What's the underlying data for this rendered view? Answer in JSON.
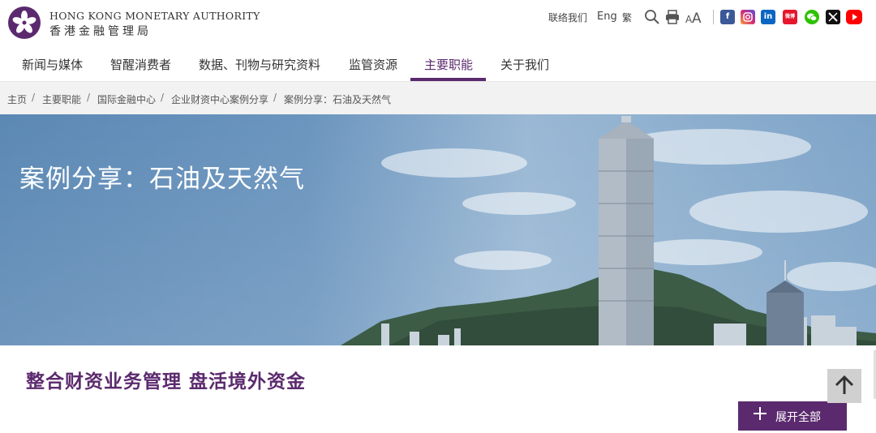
{
  "header": {
    "logo_en": "HONG KONG MONETARY AUTHORITY",
    "logo_zh": "香港金融管理局",
    "utility": {
      "contact": "联络我们",
      "eng": "Eng",
      "trad": "繁"
    },
    "icons": [
      "search-icon",
      "print-icon",
      "font-size-icon"
    ],
    "social": [
      "facebook-icon",
      "instagram-icon",
      "linkedin-icon",
      "weibo-icon",
      "wechat-icon",
      "x-icon",
      "youtube-icon"
    ]
  },
  "nav": {
    "items": [
      "新闻与媒体",
      "智醒消费者",
      "数据、刊物与研究资料",
      "监管资源",
      "主要职能",
      "关于我们"
    ],
    "active_index": 4
  },
  "breadcrumb": [
    "主页",
    "主要职能",
    "国际金融中心",
    "企业财资中心案例分享",
    "案例分享：石油及天然气"
  ],
  "banner": {
    "title": "案例分享：石油及天然气"
  },
  "content": {
    "title": "整合财资业务管理 盘活境外资金",
    "expand_label": "展开全部"
  },
  "colors": {
    "brand": "#5b2a6e",
    "breadcrumb_bg": "#f2f2f2",
    "banner_sky": "#5e8ab6"
  }
}
